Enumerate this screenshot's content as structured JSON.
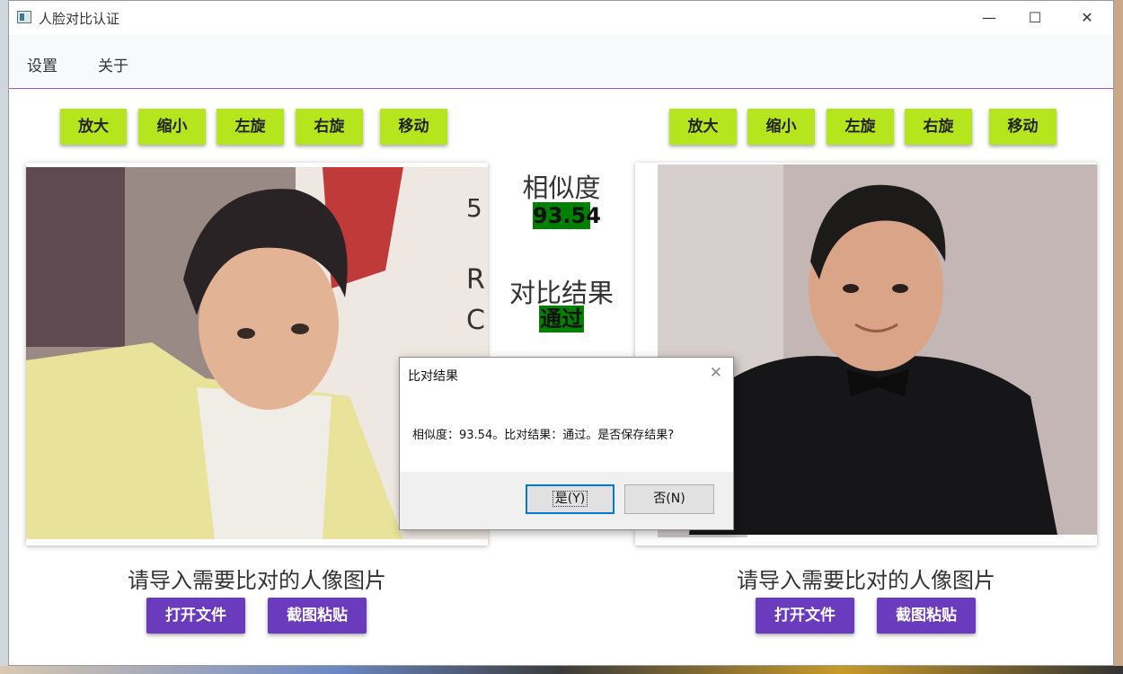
{
  "window": {
    "title": "人脸对比认证",
    "controls": {
      "minimize": "—",
      "maximize": "☐",
      "close": "✕"
    }
  },
  "menu": {
    "settings": "设置",
    "about": "关于"
  },
  "left_toolbar": [
    "放大",
    "缩小",
    "左旋",
    "右旋",
    "移动"
  ],
  "right_toolbar": [
    "放大",
    "缩小",
    "左旋",
    "右旋",
    "移动"
  ],
  "center": {
    "similarity_label": "相似度",
    "similarity_value": "93.54",
    "result_label": "对比结果",
    "result_value": "通过",
    "result_color": "#008000"
  },
  "left_panel": {
    "prompt": "请导入需要比对的人像图片",
    "open_file": "打开文件",
    "paste_screenshot": "截图粘贴"
  },
  "right_panel": {
    "prompt": "请导入需要比对的人像图片",
    "open_file": "打开文件",
    "paste_screenshot": "截图粘贴"
  },
  "dialog": {
    "title": "比对结果",
    "message": "相似度：93.54。比对结果：通过。是否保存结果?",
    "yes": "是(Y)",
    "no": "否(N)",
    "close": "✕"
  },
  "colors": {
    "tool_button": "#b5e61d",
    "action_button": "#6a3bbd",
    "menu_border": "#9b59d0"
  }
}
